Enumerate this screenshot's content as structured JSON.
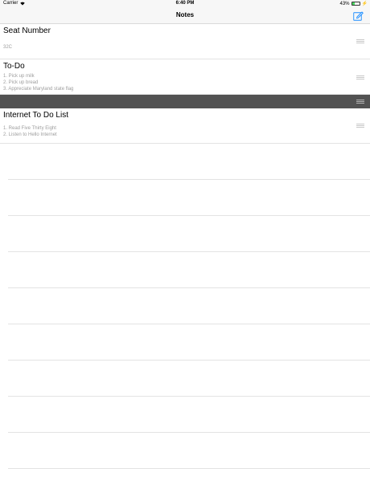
{
  "status_bar": {
    "carrier": "Carrier",
    "time": "6:40 PM",
    "battery": "43%"
  },
  "nav": {
    "title": "Notes",
    "compose_icon": "compose-icon"
  },
  "notes": [
    {
      "title": "Seat Number",
      "body": "32C"
    },
    {
      "title": "To-Do",
      "body": "1. Pick up milk\n2. Pick up bread\n3. Appreciate Maryland state flag"
    },
    {
      "title": "",
      "body": ""
    },
    {
      "title": "Internet To Do List",
      "body": "1. Read Five Thirty Eight\n2. Listen to Hello Internet"
    }
  ],
  "colors": {
    "accent": "#1a8cff",
    "drag_row": "#525252",
    "subtitle": "#9e9e9e"
  }
}
